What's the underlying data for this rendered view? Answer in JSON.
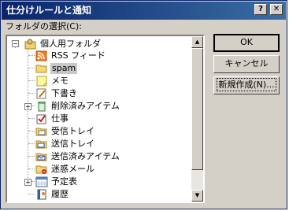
{
  "dialog": {
    "title": "仕分けルールと通知",
    "help_glyph": "?",
    "close_glyph": "✕"
  },
  "folder_label": "フォルダの選択(C):",
  "tree": {
    "root": {
      "label": "個人用フォルダ",
      "icon": "personal-folders-icon",
      "expander": "−"
    },
    "items": [
      {
        "label": "RSS フィード",
        "icon": "rss-icon"
      },
      {
        "label": "spam",
        "icon": "folder-icon",
        "selected": true
      },
      {
        "label": "メモ",
        "icon": "note-icon"
      },
      {
        "label": "下書き",
        "icon": "drafts-icon"
      },
      {
        "label": "削除済みアイテム",
        "icon": "trash-icon",
        "expander": "+"
      },
      {
        "label": "仕事",
        "icon": "tasks-icon"
      },
      {
        "label": "受信トレイ",
        "icon": "inbox-icon"
      },
      {
        "label": "送信トレイ",
        "icon": "outbox-icon"
      },
      {
        "label": "送信済みアイテム",
        "icon": "sent-items-icon"
      },
      {
        "label": "迷惑メール",
        "icon": "junk-mail-icon"
      },
      {
        "label": "予定表",
        "icon": "calendar-icon",
        "expander": "+"
      },
      {
        "label": "履歴",
        "icon": "journal-icon"
      }
    ]
  },
  "scrollbar": {
    "up_glyph": "▲",
    "down_glyph": "▼"
  },
  "buttons": {
    "ok": "OK",
    "cancel": "キャンセル",
    "new": "新規作成(N)..."
  },
  "colors": {
    "titlebar_start": "#0a246a",
    "titlebar_end": "#3a6ea5",
    "face": "#d4d0c8",
    "selection": "#c8c8c8"
  }
}
